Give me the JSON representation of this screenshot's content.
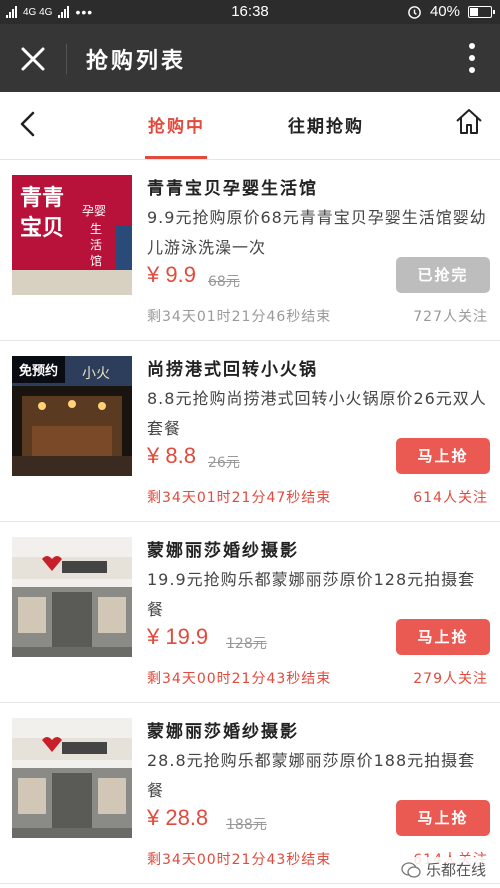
{
  "status": {
    "carrier": "4G 4G",
    "time": "16:38",
    "battery": "40%",
    "battery_level": 0.4
  },
  "header": {
    "title": "抢购列表"
  },
  "tabs": {
    "active": "抢购中",
    "other": "往期抢购"
  },
  "items": [
    {
      "name": "青青宝贝孕婴生活馆",
      "desc": "9.9元抢购原价68元青青宝贝孕婴生活馆婴幼儿游泳洗澡一次",
      "price": "¥ 9.9",
      "orig": "68元",
      "button": "已抢完",
      "remain": "剩34天01时21分46秒结束",
      "follow": "727人关注",
      "sold_out": true,
      "sign_big": "青青宝贝",
      "sign_small": "孕婴生活馆"
    },
    {
      "name": "尚捞港式回转小火锅",
      "desc": "8.8元抢购尚捞港式回转小火锅原价26元双人套餐",
      "price": "¥ 8.8",
      "orig": "26元",
      "button": "马上抢",
      "remain": "剩34天01时21分47秒结束",
      "follow": "614人关注",
      "badge": "免预约",
      "sold_out": false
    },
    {
      "name": "蒙娜丽莎婚纱摄影",
      "desc": "19.9元抢购乐都蒙娜丽莎原价128元拍摄套餐",
      "price": "¥ 19.9",
      "orig": "128元",
      "button": "马上抢",
      "remain": "剩34天00时21分43秒结束",
      "follow": "279人关注",
      "sold_out": false
    },
    {
      "name": "蒙娜丽莎婚纱摄影",
      "desc": "28.8元抢购乐都蒙娜丽莎原价188元拍摄套餐",
      "price": "¥ 28.8",
      "orig": "188元",
      "button": "马上抢",
      "remain": "剩34天00时21分43秒结束",
      "follow": "614人关注",
      "sold_out": false
    }
  ],
  "watermark": "乐都在线"
}
